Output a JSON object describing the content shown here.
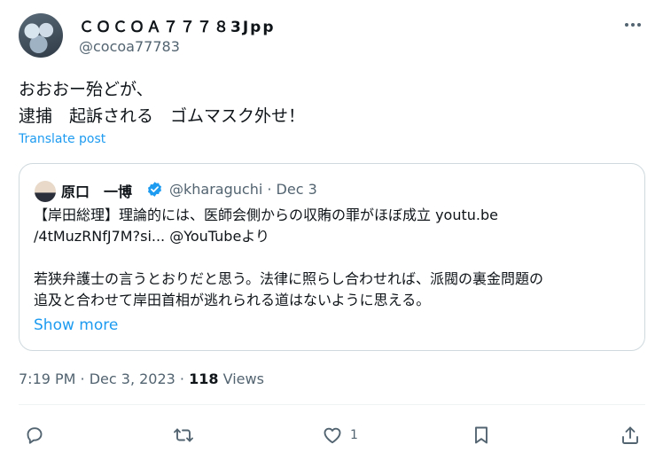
{
  "author": {
    "display_name": "ＣＯＣＯＡ７７７８3Jpp",
    "handle": "@cocoa77783"
  },
  "tweet": {
    "text": "おおおー殆どが、\n逮捕　起訴される　ゴムマスク外せ！",
    "translate_label": "Translate post"
  },
  "quoted": {
    "name": "原口　一博",
    "handle_date": "@kharaguchi · Dec 3",
    "lines": [
      "【岸田総理】理論的には、医師会側からの収賄の罪がほぼ成立 youtu.be",
      "/4tMuzRNfJ7M?si... @YouTubeより",
      "",
      "若狭弁護士の言うとおりだと思う。法律に照らし合わせれば、派閥の裏金問題の",
      "追及と合わせて岸田首相が逃れられる道はないように思える。"
    ],
    "show_more": "Show more"
  },
  "meta": {
    "time_date": "7:19 PM · Dec 3, 2023 · ",
    "views_count": "118",
    "views_label": " Views"
  },
  "actions": {
    "like_count": "1"
  },
  "icons": {
    "more": "more-horizontal-icon",
    "reply": "reply-icon",
    "repost": "repost-icon",
    "like": "heart-icon",
    "bookmark": "bookmark-icon",
    "share": "share-icon",
    "verified": "verified-badge-icon"
  },
  "colors": {
    "accent": "#1d9bf0",
    "text": "#0f1419",
    "secondary": "#536471",
    "border": "#cfd9de"
  }
}
